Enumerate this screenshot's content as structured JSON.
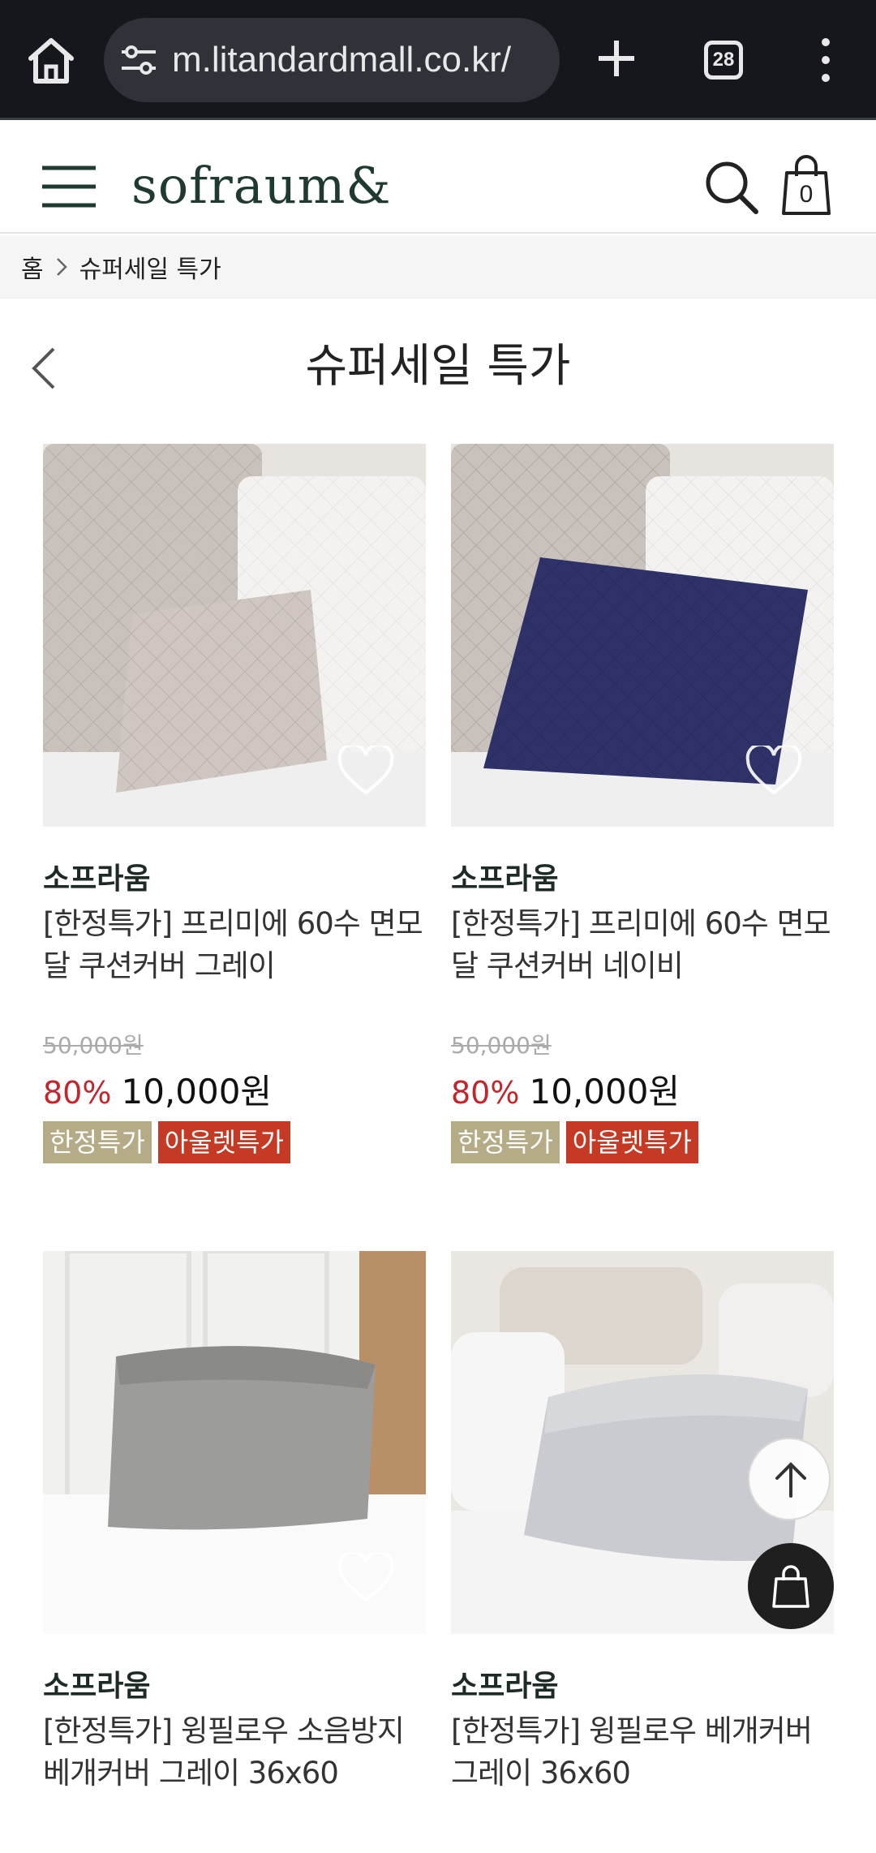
{
  "browser": {
    "url": "m.litandardmall.co.kr/",
    "tab_count": "28"
  },
  "header": {
    "logo": "sofraum&",
    "cart_count": "0"
  },
  "breadcrumb": {
    "home": "홈",
    "current": "슈퍼세일 특가"
  },
  "page": {
    "title": "슈퍼세일 특가"
  },
  "products": [
    {
      "brand": "소프라움",
      "name": "[한정특가] 프리미에 60수 면모달 쿠션커버 그레이",
      "original_price": "50,000원",
      "discount": "80%",
      "price": "10,000원",
      "badges": [
        "한정특가",
        "아울렛특가"
      ],
      "pillow_color": "#cfc6c2"
    },
    {
      "brand": "소프라움",
      "name": "[한정특가] 프리미에 60수 면모달 쿠션커버 네이비",
      "original_price": "50,000원",
      "discount": "80%",
      "price": "10,000원",
      "badges": [
        "한정특가",
        "아울렛특가"
      ],
      "pillow_color": "#2e3268"
    },
    {
      "brand": "소프라움",
      "name": "[한정특가] 윙필로우 소음방지 베개커버 그레이 36x60"
    },
    {
      "brand": "소프라움",
      "name": "[한정특가] 윙필로우 베개커버 그레이 36x60"
    }
  ],
  "colors": {
    "brand_green": "#1f3a30",
    "discount_red": "#c0272d",
    "badge_limited": "#b5ab86",
    "badge_outlet": "#c53a24"
  },
  "icons": [
    "home-icon",
    "site-settings-icon",
    "new-tab-icon",
    "tab-switcher-icon",
    "more-menu-icon",
    "menu-icon",
    "search-icon",
    "cart-icon",
    "chevron-right-icon",
    "back-icon",
    "heart-icon",
    "arrow-up-icon"
  ]
}
